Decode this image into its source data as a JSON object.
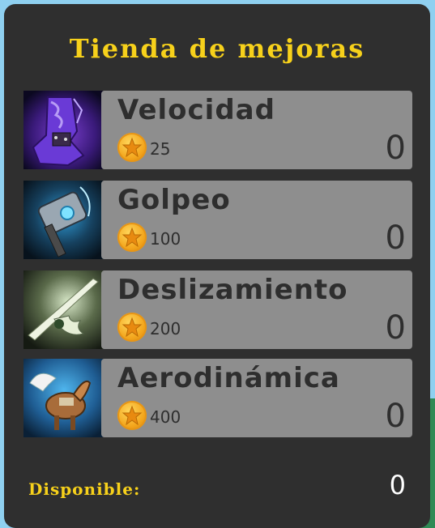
{
  "shop": {
    "title": "Tienda de mejoras",
    "upgrades": [
      {
        "name": "Velocidad",
        "cost": "25",
        "level": "0",
        "icon": "boot-icon"
      },
      {
        "name": "Golpeo",
        "cost": "100",
        "level": "0",
        "icon": "hammer-icon"
      },
      {
        "name": "Deslizamiento",
        "cost": "200",
        "level": "0",
        "icon": "winged-sword-icon"
      },
      {
        "name": "Aerodinámica",
        "cost": "400",
        "level": "0",
        "icon": "pegasus-icon"
      }
    ],
    "available_label": "Disponible:",
    "available_value": "0"
  },
  "colors": {
    "panel": "#2f2f2f",
    "card": "#8e8e8e",
    "title": "#f7d11b",
    "coin": "#f3a51c"
  }
}
